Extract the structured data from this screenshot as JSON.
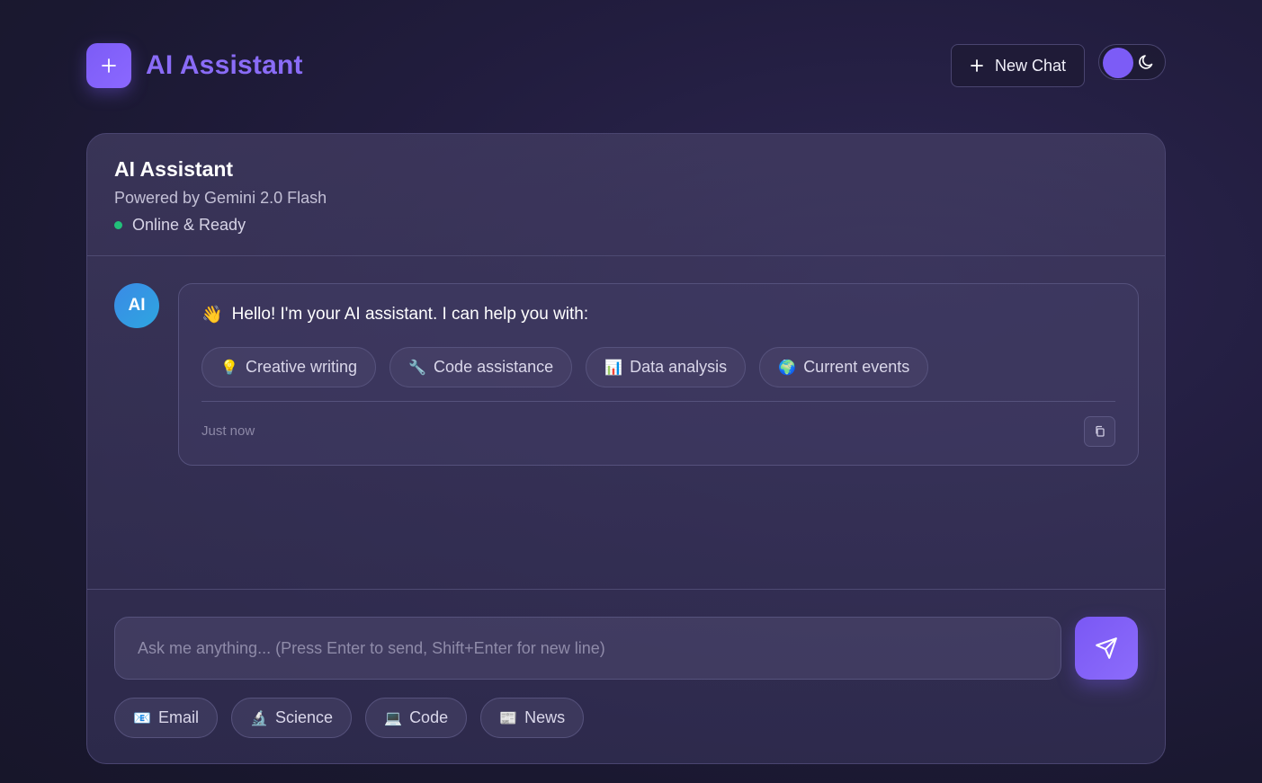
{
  "header": {
    "brand_title": "AI Assistant",
    "new_chat_label": "New Chat"
  },
  "card": {
    "title": "AI Assistant",
    "subtitle": "Powered by Gemini 2.0 Flash",
    "status": "Online & Ready",
    "status_color": "#22c07a"
  },
  "message": {
    "avatar_text": "AI",
    "greeting_emoji": "👋",
    "greeting": "Hello! I'm your AI assistant. I can help you with:",
    "chips": [
      {
        "emoji": "💡",
        "label": "Creative writing"
      },
      {
        "emoji": "🔧",
        "label": "Code assistance"
      },
      {
        "emoji": "📊",
        "label": "Data analysis"
      },
      {
        "emoji": "🌍",
        "label": "Current events"
      }
    ],
    "timestamp": "Just now"
  },
  "composer": {
    "placeholder": "Ask me anything... (Press Enter to send, Shift+Enter for new line)",
    "quick_actions": [
      {
        "emoji": "📧",
        "label": "Email"
      },
      {
        "emoji": "🔬",
        "label": "Science"
      },
      {
        "emoji": "💻",
        "label": "Code"
      },
      {
        "emoji": "📰",
        "label": "News"
      }
    ]
  },
  "colors": {
    "accent": "#7c5cf6",
    "brand_text": "#8a6cf7",
    "avatar": "#3a8ae6"
  }
}
